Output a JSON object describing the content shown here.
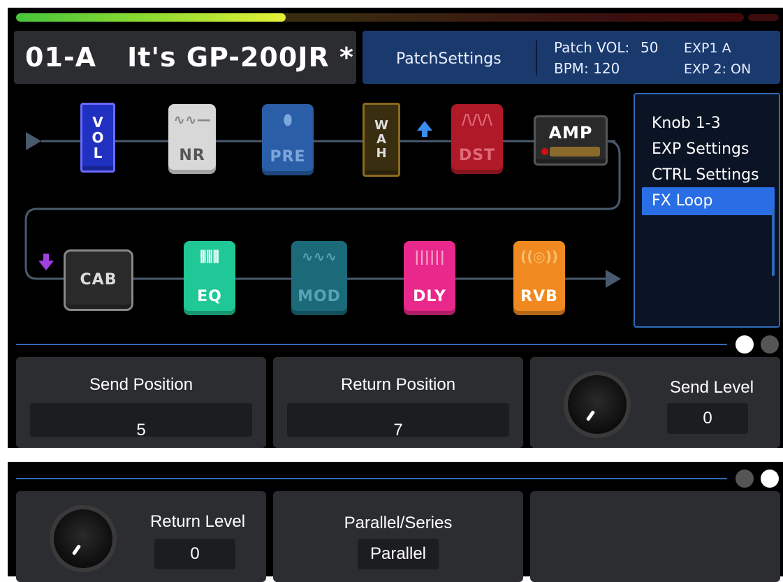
{
  "header": {
    "patch_number": "01-A",
    "patch_name": "It's GP-200JR *",
    "patch_settings_label": "PatchSettings",
    "patch_vol_label": "Patch VOL:",
    "patch_vol_value": "50",
    "bpm_text": "BPM: 120",
    "exp1_text": "EXP1 A",
    "exp2_text": "EXP 2: ON"
  },
  "meter": {
    "level": 0.37
  },
  "chain": {
    "row1": [
      {
        "id": "vol",
        "label": "VOL"
      },
      {
        "id": "nr",
        "label": "NR"
      },
      {
        "id": "pre",
        "label": "PRE"
      },
      {
        "id": "wah",
        "label": "WAH"
      },
      {
        "id": "dst",
        "label": "DST"
      },
      {
        "id": "amp",
        "label": "AMP"
      }
    ],
    "row2": [
      {
        "id": "cab",
        "label": "CAB"
      },
      {
        "id": "eq",
        "label": "EQ"
      },
      {
        "id": "mod",
        "label": "MOD"
      },
      {
        "id": "dly",
        "label": "DLY"
      },
      {
        "id": "rvb",
        "label": "RVB"
      }
    ]
  },
  "menu": {
    "items": [
      "Knob 1-3",
      "EXP Settings",
      "CTRL Settings",
      "FX Loop"
    ],
    "selected": "FX Loop"
  },
  "page1": {
    "send_position": {
      "label": "Send Position",
      "value": "5"
    },
    "return_position": {
      "label": "Return Position",
      "value": "7"
    },
    "send_level": {
      "label": "Send Level",
      "value": "0"
    }
  },
  "page2": {
    "return_level": {
      "label": "Return Level",
      "value": "0"
    },
    "parallel_series": {
      "label": "Parallel/Series",
      "value": "Parallel"
    }
  },
  "colors": {
    "accent_blue": "#2a6ee6",
    "header_blue": "#1a3a6e",
    "panel_gray": "#2b2d30"
  }
}
